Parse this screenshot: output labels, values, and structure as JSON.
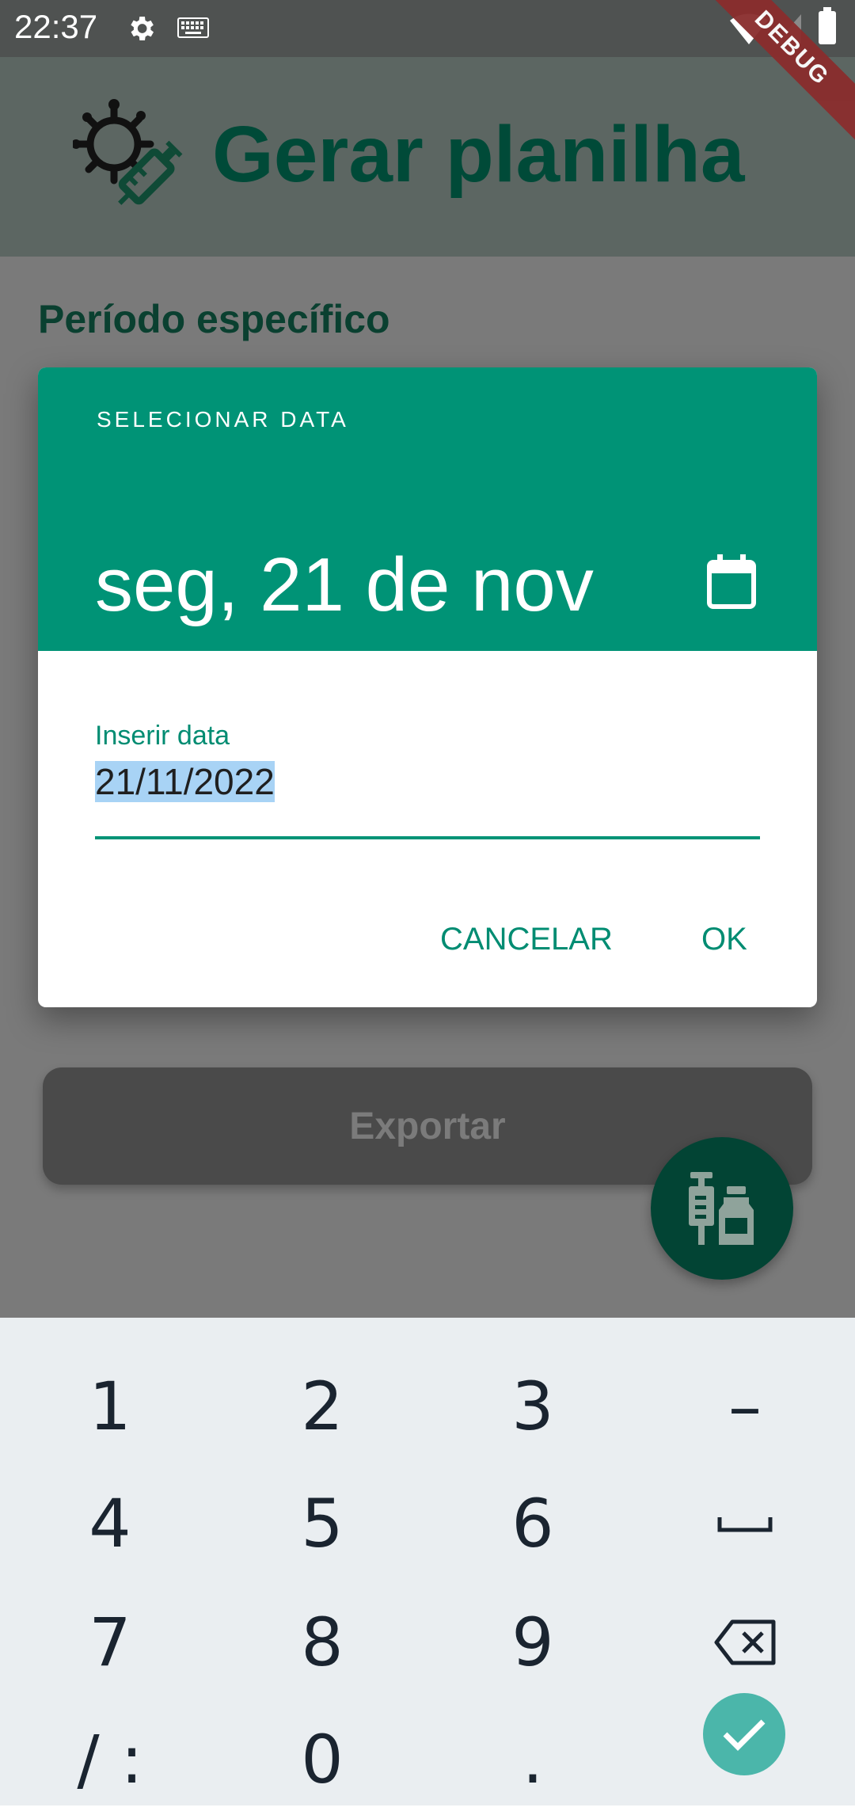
{
  "status_bar": {
    "time": "22:37",
    "icons": [
      "settings-icon",
      "keyboard-icon",
      "wifi-icon",
      "signal-icon",
      "battery-icon"
    ]
  },
  "debug_banner": "DEBUG",
  "app_bar": {
    "title": "Gerar planilha",
    "logo_icon": "virus-syringe-icon"
  },
  "main": {
    "section_title": "Período específico",
    "export_label": "Exportar",
    "fab_icon": "syringe-vial-icon"
  },
  "dialog": {
    "overline": "SELECIONAR DATA",
    "selected_date": "seg, 21 de nov",
    "mode_icon": "calendar-icon",
    "input_label": "Inserir data",
    "input_value": "21/11/2022",
    "cancel_label": "CANCELAR",
    "ok_label": "OK"
  },
  "keyboard": {
    "keys": [
      "1",
      "2",
      "3",
      "–",
      "4",
      "5",
      "6",
      "␣",
      "7",
      "8",
      "9",
      "backspace",
      "/ :",
      "0",
      ".",
      "enter"
    ]
  },
  "colors": {
    "header_green": "#009376",
    "accent_text": "#008c72",
    "title_dark_green": "#004a38",
    "fab_green": "#024434",
    "enter_teal": "#4bb6aa"
  }
}
